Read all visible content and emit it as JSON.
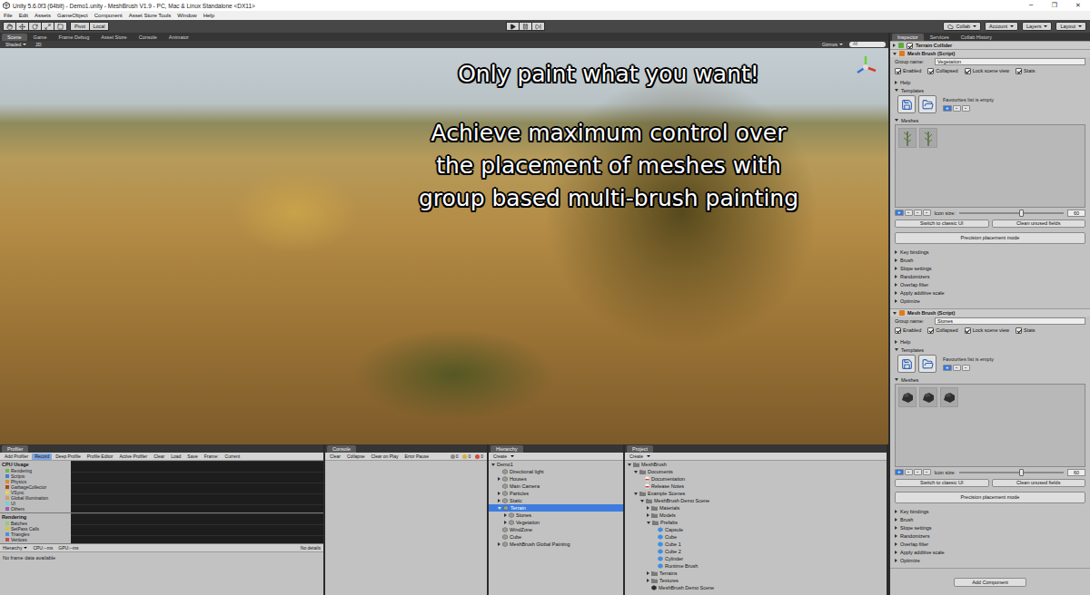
{
  "window": {
    "title": "Unity 5.6.0f3 (64bit) - Demo1.unity - MeshBrush V1.9 - PC, Mac & Linux Standalone <DX11>",
    "controls": [
      "─",
      "❐",
      "✕"
    ]
  },
  "menu": [
    "File",
    "Edit",
    "Assets",
    "GameObject",
    "Component",
    "Asset Store Tools",
    "Window",
    "Help"
  ],
  "toolbar": {
    "pivot": "Pivot",
    "local": "Local",
    "right": [
      "Collab",
      "Account",
      "Layers",
      "Layout"
    ]
  },
  "scene": {
    "tabs": [
      {
        "label": "Scene",
        "selected": true
      },
      {
        "label": "Game",
        "selected": false
      },
      {
        "label": "Frame Debug",
        "selected": false
      },
      {
        "label": "Asset Store",
        "selected": false
      },
      {
        "label": "Console",
        "selected": false
      },
      {
        "label": "Animator",
        "selected": false
      }
    ],
    "shading": "Shaded",
    "mode": "2D",
    "gizmos": "Gizmos",
    "search": "All",
    "headline": "Only paint what you want!",
    "body": [
      "Achieve maximum control over",
      "the placement of meshes with",
      "group based multi-brush painting"
    ]
  },
  "inspector": {
    "tabs": [
      {
        "label": "Inspector",
        "selected": true
      },
      {
        "label": "Services",
        "selected": false
      },
      {
        "label": "Collab History",
        "selected": false
      }
    ],
    "terrain_collider": {
      "label": "Terrain Collider",
      "enabled": true
    },
    "brushes": [
      {
        "title": "Mesh Brush (Script)",
        "group_label": "Group name:",
        "group_name": "Vegetation",
        "toggles": [
          {
            "label": "Enabled",
            "checked": true
          },
          {
            "label": "Collapsed",
            "checked": true
          },
          {
            "label": "Lock scene view",
            "checked": true
          },
          {
            "label": "Stats",
            "checked": true
          }
        ],
        "sections": [
          {
            "label": "Help",
            "expanded": false
          },
          {
            "label": "Templates",
            "expanded": true
          }
        ],
        "favourites_text": "Favourites list is empty",
        "favourites_buttons": [
          "+",
          "-",
          "-"
        ],
        "meshes_section": {
          "label": "Meshes",
          "expanded": true
        },
        "meshes": [
          {
            "kind": "plant"
          },
          {
            "kind": "plant"
          }
        ],
        "mesh_buttons": [
          "+",
          "-",
          "-",
          "-"
        ],
        "icon_size_label": "Icon size:",
        "icon_size": "60",
        "icon_size_level": 0.6,
        "buttons": [
          "Switch to classic UI",
          "Clean unused fields"
        ],
        "precision_button": "Precision placement mode",
        "foldouts": [
          {
            "label": "Key bindings",
            "expanded": false
          },
          {
            "label": "Brush",
            "expanded": false
          },
          {
            "label": "Slope settings",
            "expanded": false
          },
          {
            "label": "Randomizers",
            "expanded": false
          },
          {
            "label": "Overlap filter",
            "expanded": false
          },
          {
            "label": "Apply additive scale",
            "expanded": false
          },
          {
            "label": "Optimize",
            "expanded": false
          }
        ]
      },
      {
        "title": "Mesh Brush (Script)",
        "group_label": "Group name:",
        "group_name": "Stones",
        "toggles": [
          {
            "label": "Enabled",
            "checked": true
          },
          {
            "label": "Collapsed",
            "checked": true
          },
          {
            "label": "Lock scene view",
            "checked": true
          },
          {
            "label": "Stats",
            "checked": true
          }
        ],
        "sections": [
          {
            "label": "Help",
            "expanded": false
          },
          {
            "label": "Templates",
            "expanded": true
          }
        ],
        "favourites_text": "Favourites list is empty",
        "favourites_buttons": [
          "+",
          "-",
          "-"
        ],
        "meshes_section": {
          "label": "Meshes",
          "expanded": true
        },
        "meshes": [
          {
            "kind": "rock"
          },
          {
            "kind": "rock"
          },
          {
            "kind": "rock"
          }
        ],
        "mesh_buttons": [
          "+",
          "-",
          "-",
          "-"
        ],
        "icon_size_label": "Icon size:",
        "icon_size": "60",
        "icon_size_level": 0.6,
        "buttons": [
          "Switch to classic UI",
          "Clean unused fields"
        ],
        "precision_button": "Precision placement mode",
        "foldouts": [
          {
            "label": "Key bindings",
            "expanded": false
          },
          {
            "label": "Brush",
            "expanded": false
          },
          {
            "label": "Slope settings",
            "expanded": false
          },
          {
            "label": "Randomizers",
            "expanded": false
          },
          {
            "label": "Overlap filter",
            "expanded": false
          },
          {
            "label": "Apply additive scale",
            "expanded": false
          },
          {
            "label": "Optimize",
            "expanded": false
          }
        ]
      }
    ],
    "add_component": "Add Component"
  },
  "profiler": {
    "title": "Profiler",
    "toolbar": [
      {
        "label": "Add Profiler",
        "selected": false
      },
      {
        "label": "Record",
        "selected": true
      },
      {
        "label": "Deep Profile",
        "selected": false
      },
      {
        "label": "Profile Editor",
        "selected": false
      },
      {
        "label": "Active Profiler",
        "selected": false
      },
      {
        "label": "Clear",
        "selected": false
      },
      {
        "label": "Load",
        "selected": false
      },
      {
        "label": "Save",
        "selected": false
      },
      {
        "label": "Frame:",
        "selected": false
      },
      {
        "label": "Current",
        "selected": false
      }
    ],
    "cpu": {
      "label": "CPU Usage",
      "items": [
        {
          "label": "Rendering",
          "color": "#6fb84a"
        },
        {
          "label": "Scripts",
          "color": "#3b82d6"
        },
        {
          "label": "Physics",
          "color": "#e08a2b"
        },
        {
          "label": "GarbageCollector",
          "color": "#b2441e"
        },
        {
          "label": "VSync",
          "color": "#e8d54a"
        },
        {
          "label": "Global Illumination",
          "color": "#c9a06a"
        },
        {
          "label": "UI",
          "color": "#6fd0e0"
        },
        {
          "label": "Others",
          "color": "#9b59b6"
        }
      ]
    },
    "rendering": {
      "label": "Rendering",
      "items": [
        {
          "label": "Batches",
          "color": "#8ad06b"
        },
        {
          "label": "SetPass Calls",
          "color": "#d6c43b"
        },
        {
          "label": "Triangles",
          "color": "#4a90e2"
        },
        {
          "label": "Vertices",
          "color": "#c05050"
        }
      ]
    },
    "footer": [
      "Hierarchy",
      "CPU:--ms",
      "GPU:--ms"
    ],
    "details": "No details",
    "empty": "No frame data available"
  },
  "console": {
    "title": "Console",
    "toolbar": [
      {
        "label": "Clear",
        "selected": false
      },
      {
        "label": "Collapse",
        "selected": false
      },
      {
        "label": "Clear on Play",
        "selected": false
      },
      {
        "label": "Error Pause",
        "selected": false
      }
    ],
    "counts": [
      "0",
      "0",
      "0"
    ]
  },
  "hierarchy": {
    "title": "Hierarchy",
    "create": "Create",
    "rows": [
      {
        "label": "Demo1",
        "depth": 0,
        "has_children": true,
        "expanded": true,
        "selected": false
      },
      {
        "label": "Directional light",
        "depth": 1,
        "has_children": false,
        "expanded": false,
        "selected": false
      },
      {
        "label": "Houses",
        "depth": 1,
        "has_children": true,
        "expanded": false,
        "selected": false
      },
      {
        "label": "Main Camera",
        "depth": 1,
        "has_children": false,
        "expanded": false,
        "selected": false
      },
      {
        "label": "Particles",
        "depth": 1,
        "has_children": true,
        "expanded": false,
        "selected": false
      },
      {
        "label": "Static",
        "depth": 1,
        "has_children": true,
        "expanded": false,
        "selected": false
      },
      {
        "label": "Terrain",
        "depth": 1,
        "has_children": true,
        "expanded": true,
        "selected": true
      },
      {
        "label": "Stones",
        "depth": 2,
        "has_children": true,
        "expanded": false,
        "selected": false
      },
      {
        "label": "Vegetation",
        "depth": 2,
        "has_children": true,
        "expanded": false,
        "selected": false
      },
      {
        "label": "WindZone",
        "depth": 1,
        "has_children": false,
        "expanded": false,
        "selected": false
      },
      {
        "label": "Cube",
        "depth": 1,
        "has_children": false,
        "expanded": false,
        "selected": false
      },
      {
        "label": "MeshBrush Global Painting",
        "depth": 1,
        "has_children": true,
        "expanded": false,
        "selected": false
      }
    ]
  },
  "project": {
    "title": "Project",
    "create": "Create",
    "rows": [
      {
        "label": "MeshBrush",
        "depth": 0,
        "kind": "folder",
        "has_children": true,
        "expanded": true
      },
      {
        "label": "Documents",
        "depth": 1,
        "kind": "folder",
        "has_children": true,
        "expanded": true
      },
      {
        "label": "Documentation",
        "depth": 2,
        "kind": "doc",
        "has_children": false,
        "expanded": false
      },
      {
        "label": "Release Notes",
        "depth": 2,
        "kind": "doc",
        "has_children": false,
        "expanded": false
      },
      {
        "label": "Example Scenes",
        "depth": 1,
        "kind": "folder",
        "has_children": true,
        "expanded": true
      },
      {
        "label": "MeshBrush Demo Scene",
        "depth": 2,
        "kind": "folder",
        "has_children": true,
        "expanded": true
      },
      {
        "label": "Materials",
        "depth": 3,
        "kind": "folder",
        "has_children": true,
        "expanded": false
      },
      {
        "label": "Models",
        "depth": 3,
        "kind": "folder",
        "has_children": true,
        "expanded": false
      },
      {
        "label": "Prefabs",
        "depth": 3,
        "kind": "folder",
        "has_children": true,
        "expanded": true
      },
      {
        "label": "Capsule",
        "depth": 4,
        "kind": "prefab",
        "has_children": false,
        "expanded": false
      },
      {
        "label": "Cube",
        "depth": 4,
        "kind": "prefab",
        "has_children": false,
        "expanded": false
      },
      {
        "label": "Cube 1",
        "depth": 4,
        "kind": "prefab",
        "has_children": false,
        "expanded": false
      },
      {
        "label": "Cube 2",
        "depth": 4,
        "kind": "prefab",
        "has_children": false,
        "expanded": false
      },
      {
        "label": "Cylinder",
        "depth": 4,
        "kind": "prefab",
        "has_children": false,
        "expanded": false
      },
      {
        "label": "Runtime Brush",
        "depth": 4,
        "kind": "prefab",
        "has_children": false,
        "expanded": false
      },
      {
        "label": "Terrains",
        "depth": 3,
        "kind": "folder",
        "has_children": true,
        "expanded": false
      },
      {
        "label": "Textures",
        "depth": 3,
        "kind": "folder",
        "has_children": true,
        "expanded": false
      },
      {
        "label": "MeshBrush Demo Scene",
        "depth": 3,
        "kind": "scene",
        "has_children": false,
        "expanded": false
      }
    ]
  }
}
